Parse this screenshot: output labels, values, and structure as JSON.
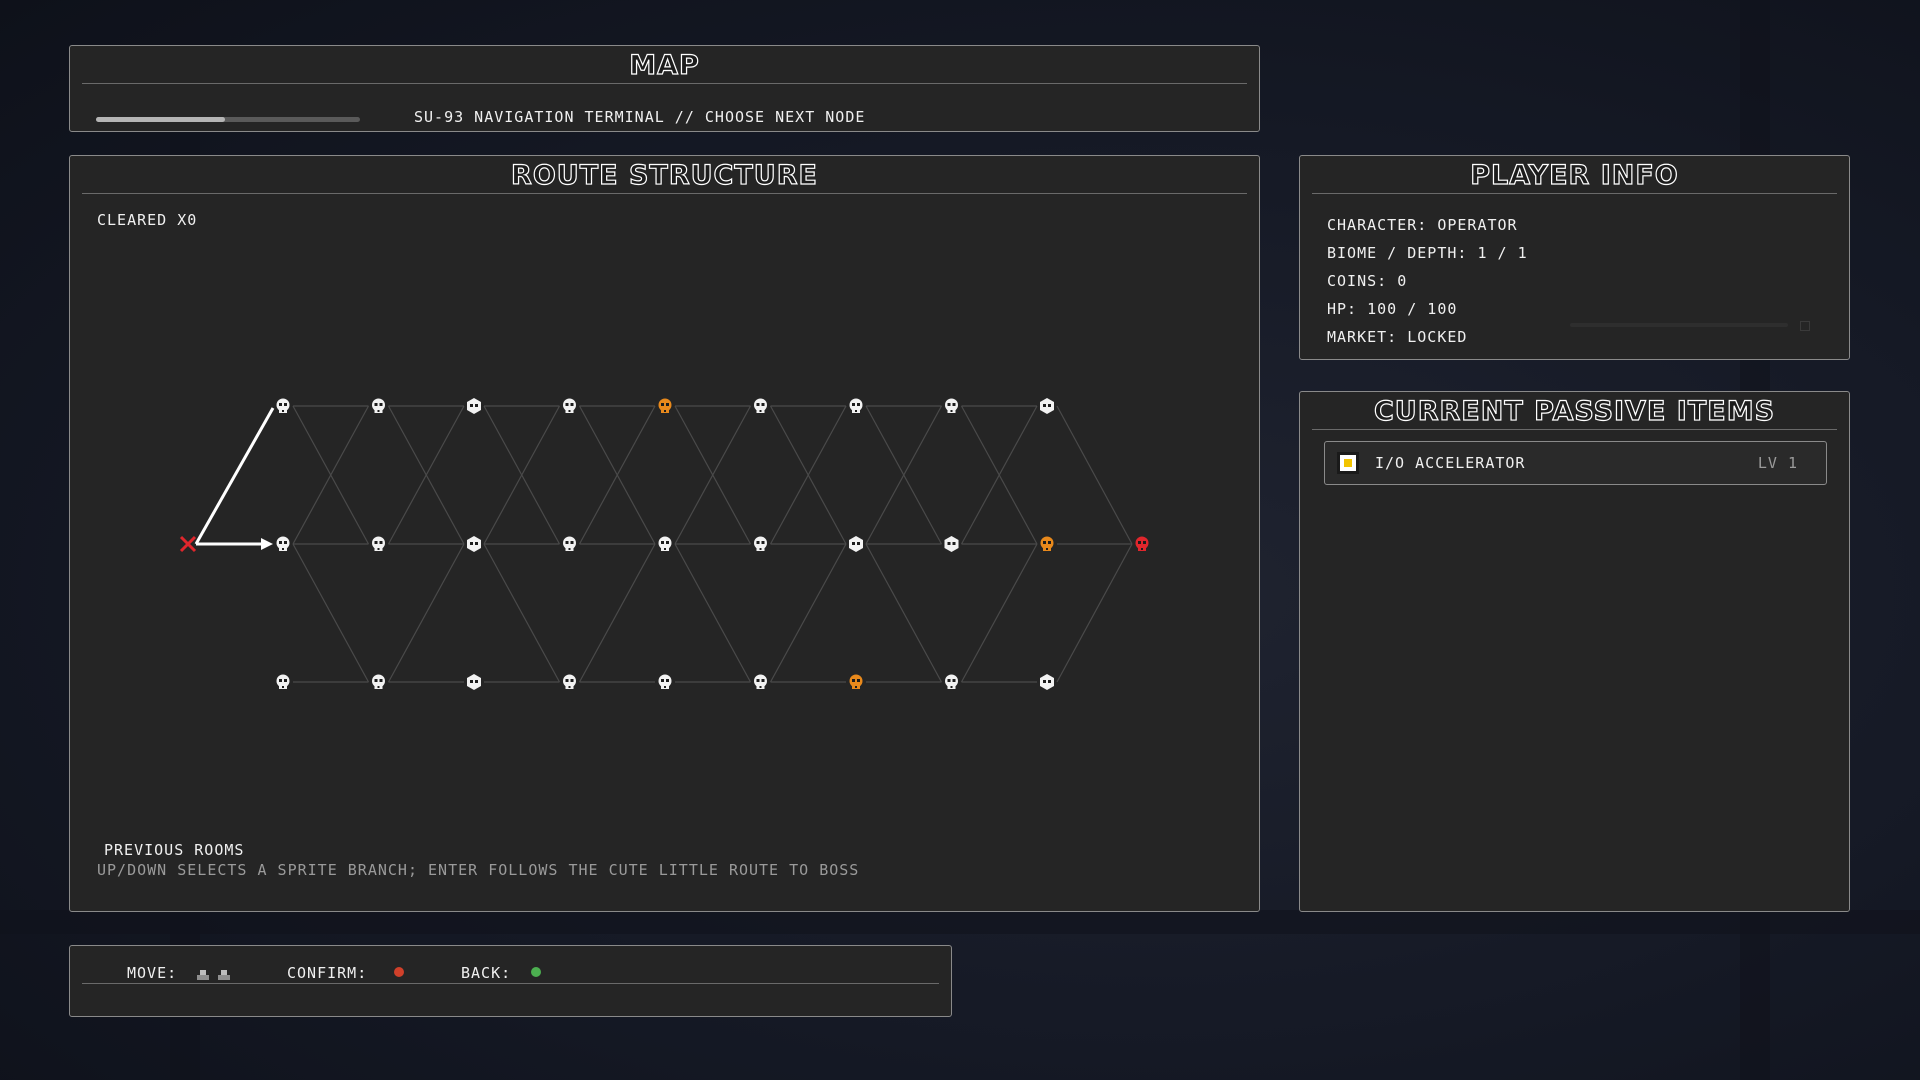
{
  "map_panel": {
    "title": "MAP",
    "subtitle": "SU-93 NAVIGATION TERMINAL // CHOOSE NEXT NODE",
    "progress": 0.49
  },
  "route_panel": {
    "title": "ROUTE STRUCTURE",
    "cleared": "CLEARED X0",
    "previous_rooms": "PREVIOUS ROOMS",
    "help": "UP/DOWN SELECTS A SPRITE BRANCH; ENTER FOLLOWS THE CUTE LITTLE ROUTE TO BOSS"
  },
  "route_graph": {
    "colors": {
      "white": "#f2f2f2",
      "orange": "#e8891c",
      "red": "#e0262c",
      "edge": "#4a4a4a",
      "path": "#ffffff"
    },
    "rows": [
      [
        "skull",
        "skull",
        "elite",
        "skull",
        "skull-orange",
        "skull",
        "skull",
        "skull",
        "elite"
      ],
      [
        "skull",
        "skull",
        "elite",
        "skull",
        "skull",
        "skull",
        "elite",
        "elite",
        "skull-orange"
      ],
      [
        "skull",
        "skull",
        "elite",
        "skull",
        "skull",
        "skull",
        "skull-orange",
        "skull",
        "elite"
      ]
    ],
    "boss": "skull-red",
    "start": "x-mark"
  },
  "player_panel": {
    "title": "PLAYER INFO",
    "lines": [
      "CHARACTER: OPERATOR",
      "BIOME / DEPTH: 1 / 1",
      "COINS: 0",
      "HP: 100 / 100",
      "MARKET: LOCKED"
    ]
  },
  "passive_panel": {
    "title": "CURRENT PASSIVE ITEMS",
    "items": [
      {
        "name": "I/O ACCELERATOR",
        "level": "LV 1",
        "icon": "chip-icon"
      }
    ]
  },
  "controls": {
    "move_label": "MOVE:",
    "confirm_label": "CONFIRM:",
    "back_label": "BACK:",
    "confirm_color": "#d0402a",
    "back_color": "#4caf50"
  }
}
